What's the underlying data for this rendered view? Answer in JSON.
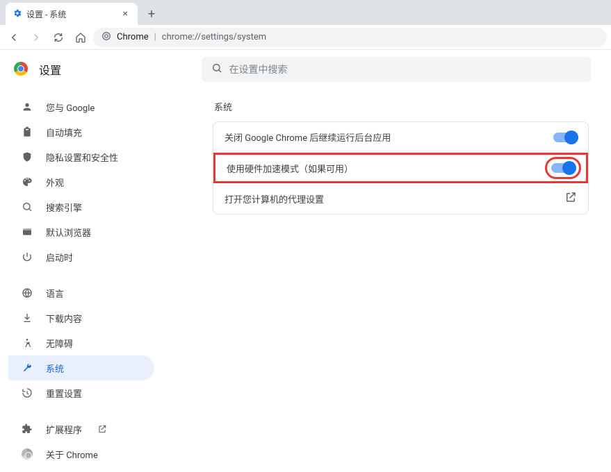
{
  "tab": {
    "title": "设置 - 系统"
  },
  "omnibox": {
    "host": "Chrome",
    "path": "chrome://settings/system"
  },
  "header": {
    "title": "设置",
    "search_placeholder": "在设置中搜索"
  },
  "sidebar": {
    "items": [
      {
        "label": "您与 Google",
        "icon": "person-icon"
      },
      {
        "label": "自动填充",
        "icon": "clipboard-icon"
      },
      {
        "label": "隐私设置和安全性",
        "icon": "shield-icon"
      },
      {
        "label": "外观",
        "icon": "palette-icon"
      },
      {
        "label": "搜索引擎",
        "icon": "search-icon"
      },
      {
        "label": "默认浏览器",
        "icon": "browser-icon"
      },
      {
        "label": "启动时",
        "icon": "power-icon"
      }
    ],
    "items2": [
      {
        "label": "语言",
        "icon": "globe-icon"
      },
      {
        "label": "下载内容",
        "icon": "download-icon"
      },
      {
        "label": "无障碍",
        "icon": "accessibility-icon"
      },
      {
        "label": "系统",
        "icon": "wrench-icon",
        "active": true
      },
      {
        "label": "重置设置",
        "icon": "restore-icon"
      }
    ],
    "items3": [
      {
        "label": "扩展程序",
        "icon": "extension-icon",
        "external": true
      },
      {
        "label": "关于 Chrome",
        "icon": "chrome-icon"
      }
    ]
  },
  "main": {
    "section_title": "系统",
    "rows": [
      {
        "label": "关闭 Google Chrome 后继续运行后台应用",
        "toggle": true
      },
      {
        "label": "使用硬件加速模式（如果可用）",
        "toggle": true,
        "highlight": true
      },
      {
        "label": "打开您计算机的代理设置",
        "launch": true
      }
    ]
  }
}
